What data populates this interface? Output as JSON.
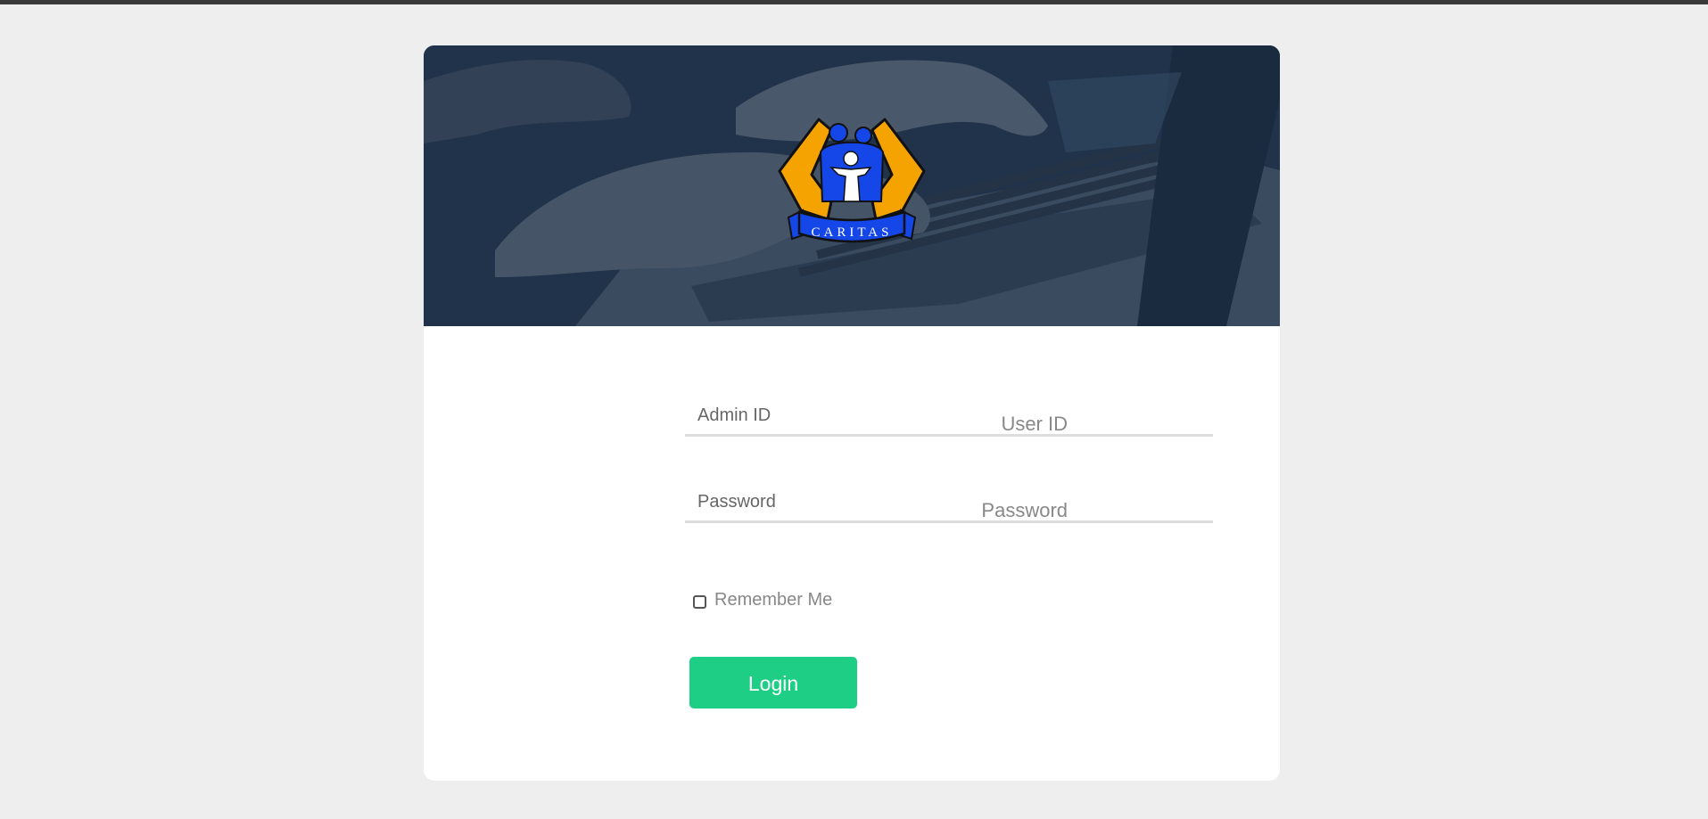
{
  "login": {
    "logo_text": "CARITAS",
    "user_id_label": "User ID",
    "user_id_placeholder": "Admin ID",
    "password_label": "Password",
    "password_placeholder": "Password",
    "remember_label": "Remember Me",
    "login_label": "Login"
  },
  "colors": {
    "page_background": "#eeeeee",
    "banner_overlay": "#1f3147",
    "login_button": "#1ece85",
    "logo_orange": "#f5a300",
    "logo_blue": "#1446e8"
  },
  "icons": {
    "logo": "caritas-logo-icon",
    "checkbox": "checkbox-icon"
  }
}
